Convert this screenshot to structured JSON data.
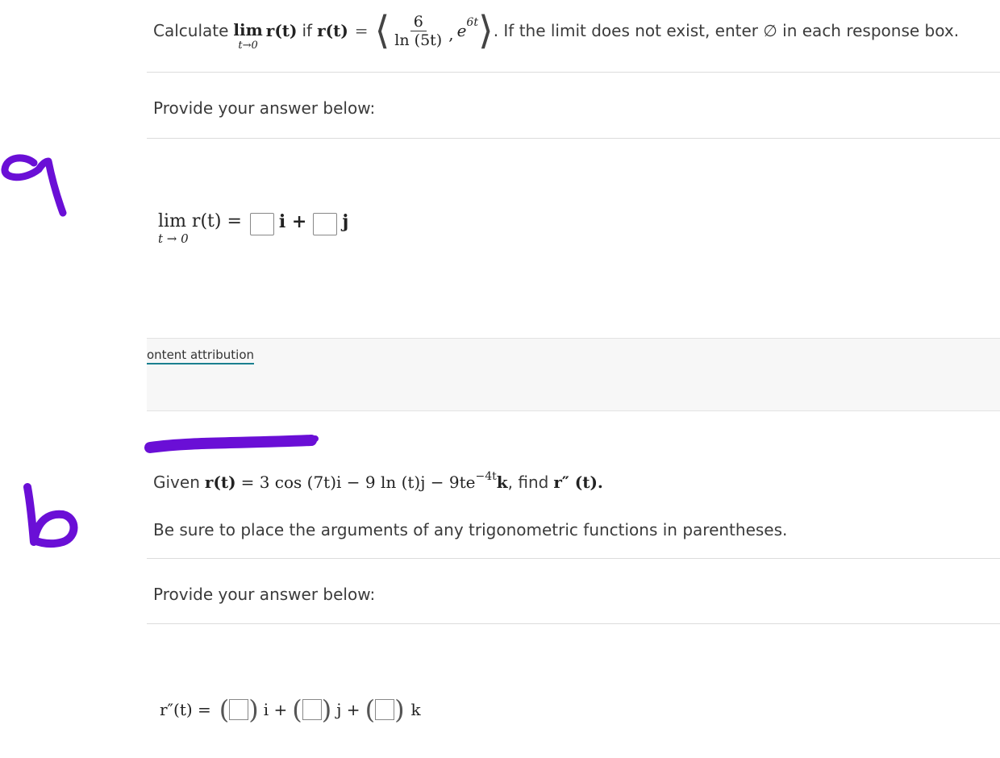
{
  "part_a": {
    "q_prefix": "Calculate",
    "lim": "lim",
    "lim_sub": "t→0",
    "r_of_t": "r(t)",
    "if_text": "if",
    "eq": "=",
    "frac_num": "6",
    "frac_den": "ln (5t)",
    "comma": ",",
    "exp_base": "e",
    "exp_power": "6t",
    "q_suffix": ". If the limit does not exist, enter ∅ in each response box.",
    "provide": "Provide your answer below:",
    "ans_lim": "lim r(t) =",
    "ans_sub": "t → 0",
    "i_label": "i +",
    "j_label": "j"
  },
  "attribution": {
    "label": "ontent attribution"
  },
  "part_b": {
    "given": "Given",
    "r_of_t": "r(t)",
    "equation": "= 3 cos (7t)i − 9 ln (t)j − 9te",
    "exp": "−4t",
    "k_tail": "k",
    "find": ", find",
    "rpp": "r″ (t).",
    "instruction": "Be sure to place the arguments of any trigonometric functions in parentheses.",
    "provide": "Provide your answer below:",
    "ans_label": "r″(t) =",
    "i_label": "i +",
    "j_label": "j +",
    "k_label": "k"
  },
  "annotations": {
    "mark_a": "a",
    "mark_b": "b",
    "ink_color": "#6a0fd6"
  }
}
